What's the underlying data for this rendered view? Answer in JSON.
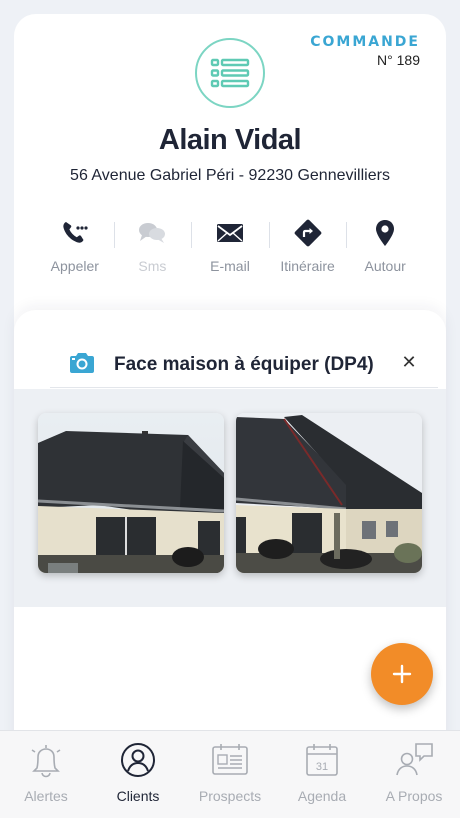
{
  "order": {
    "label": "COMMANDE",
    "number": "N° 189"
  },
  "client": {
    "name": "Alain Vidal",
    "address": "56 Avenue Gabriel Péri - 92230 Gennevilliers"
  },
  "actions": [
    {
      "label": "Appeler",
      "icon": "phone-icon",
      "enabled": true
    },
    {
      "label": "Sms",
      "icon": "sms-icon",
      "enabled": false
    },
    {
      "label": "E-mail",
      "icon": "mail-icon",
      "enabled": true
    },
    {
      "label": "Itinéraire",
      "icon": "directions-icon",
      "enabled": true
    },
    {
      "label": "Autour",
      "icon": "location-pin-icon",
      "enabled": true
    }
  ],
  "photos": {
    "title": "Face maison à équiper (DP4)",
    "close_symbol": "✕",
    "count": 2
  },
  "fab": {
    "symbol": "+"
  },
  "tabs": [
    {
      "label": "Alertes",
      "icon": "bell-icon",
      "active": false
    },
    {
      "label": "Clients",
      "icon": "user-icon",
      "active": true
    },
    {
      "label": "Prospects",
      "icon": "prospects-icon",
      "active": false
    },
    {
      "label": "Agenda",
      "icon": "calendar-icon",
      "active": false,
      "day": "31"
    },
    {
      "label": "A Propos",
      "icon": "about-icon",
      "active": false
    }
  ],
  "colors": {
    "accent": "#3aa6d3",
    "badge_ring": "#7cd5c3",
    "fab": "#f28c28",
    "text_dark": "#1f2536"
  }
}
